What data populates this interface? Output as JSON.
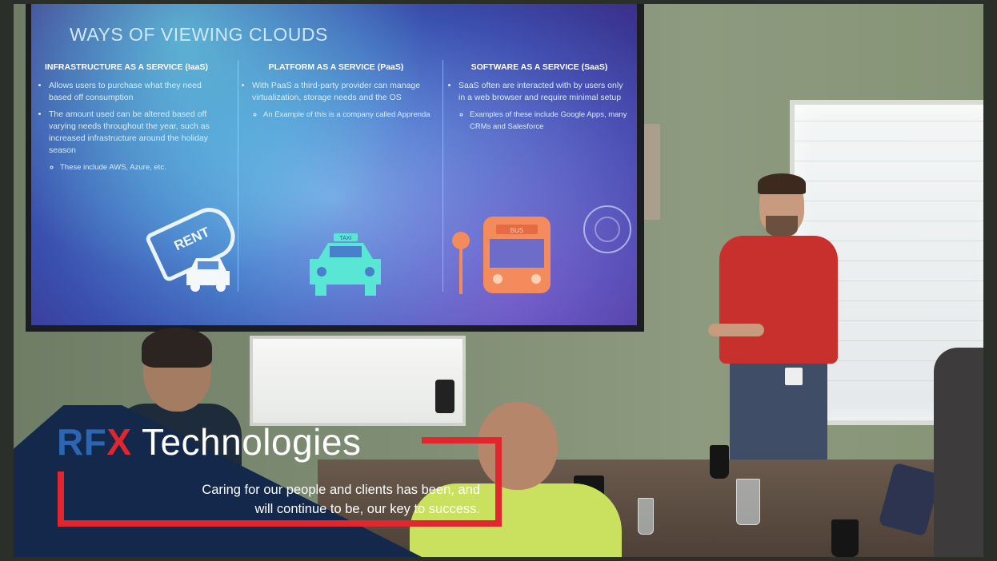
{
  "slide": {
    "title": "WAYS OF VIEWING CLOUDS",
    "columns": [
      {
        "heading": "INFRASTRUCTURE AS A SERVICE (IaaS)",
        "bullets": [
          "Allows users to purchase what they need based off consumption",
          "The amount used can be altered based off varying needs throughout the year, such as increased infrastructure around the holiday season"
        ],
        "sub_bullet": "These include AWS, Azure, etc.",
        "icon": "rent-car-icon",
        "icon_label": "RENT"
      },
      {
        "heading": "PLATFORM AS A SERVICE (PaaS)",
        "bullets": [
          "With PaaS a third-party provider can manage virtualization, storage needs and the OS"
        ],
        "sub_bullet": "An Example of this is a company called Apprenda",
        "icon": "taxi-icon",
        "icon_label": "TAXI"
      },
      {
        "heading": "SOFTWARE AS A SERVICE (SaaS)",
        "bullets": [
          "SaaS often are interacted with by users only in a web browser and require minimal setup"
        ],
        "sub_bullet": "Examples of these include Google Apps, many CRMs and Salesforce",
        "icon": "bus-icon",
        "icon_label": "BUS"
      }
    ]
  },
  "overlay": {
    "brand_rf": "RF",
    "brand_x": "X",
    "brand_rest": " Technologies",
    "tagline_line1": "Caring for our people and clients has been, and",
    "tagline_line2": "will continue to be, our key to success.",
    "colors": {
      "blue": "#2c66b3",
      "red": "#e1262e",
      "navy": "#13284a"
    }
  }
}
